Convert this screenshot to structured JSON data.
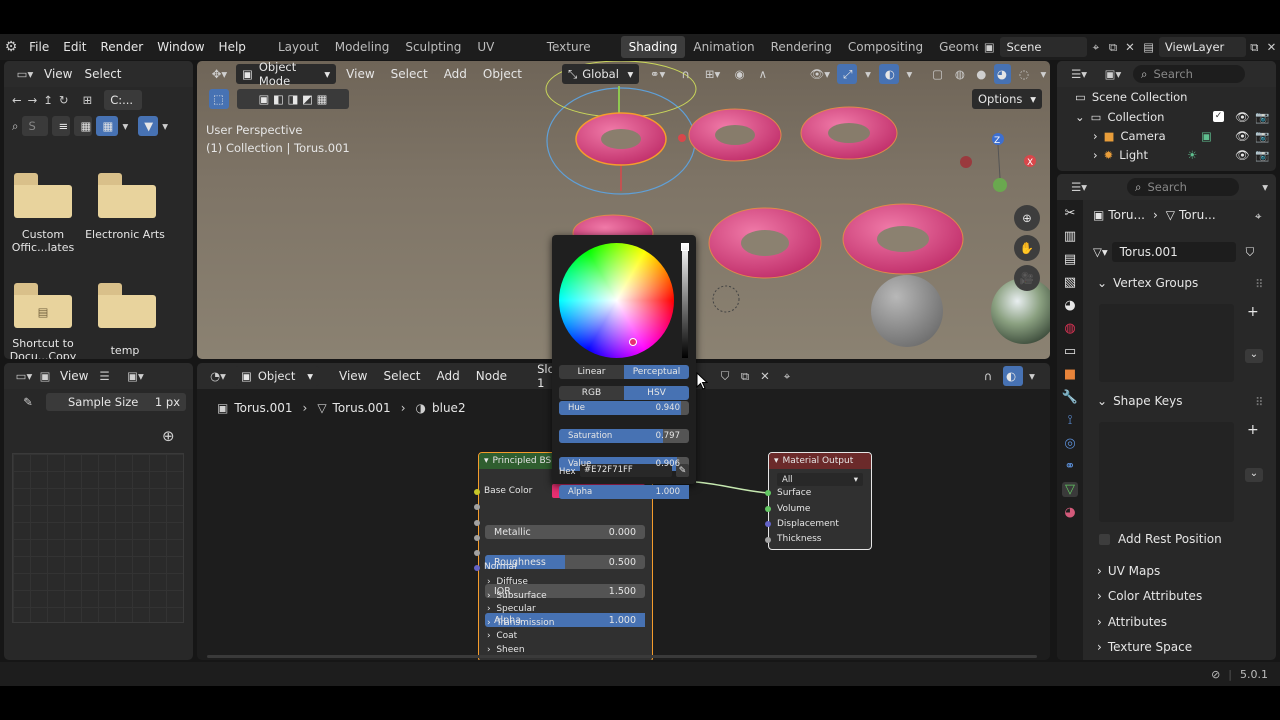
{
  "menubar": {
    "items": [
      "File",
      "Edit",
      "Render",
      "Window",
      "Help"
    ],
    "workspaces": [
      "Layout",
      "Modeling",
      "Sculpting",
      "UV Editing",
      "Texture Paint",
      "Shading",
      "Animation",
      "Rendering",
      "Compositing",
      "Geomet"
    ],
    "active_workspace": "Shading",
    "scene": "Scene",
    "view_layer": "ViewLayer"
  },
  "file_browser": {
    "view": "View",
    "select": "Select",
    "path": "C:...",
    "search_placeholder": "S",
    "items": [
      {
        "name": "Custom Offic...lates",
        "type": "folder"
      },
      {
        "name": "Electronic Arts",
        "type": "folder"
      },
      {
        "name": "Shortcut to Docu...Copy",
        "type": "shortcut"
      },
      {
        "name": "temp",
        "type": "folder"
      }
    ]
  },
  "image_editor": {
    "view": "View",
    "sample_label": "Sample Size",
    "sample_value": "1 px"
  },
  "viewport": {
    "mode": "Object Mode",
    "menus": [
      "View",
      "Select",
      "Add",
      "Object"
    ],
    "orientation": "Global",
    "options": "Options",
    "overlay_line1": "User Perspective",
    "overlay_line2": "(1) Collection | Torus.001",
    "gizmo_z": "Z",
    "gizmo_x": "X"
  },
  "node_editor": {
    "type": "Object",
    "menus": [
      "View",
      "Select",
      "Add",
      "Node"
    ],
    "slot": "Slot 1",
    "breadcrumb": [
      "Torus.001",
      "Torus.001",
      "blue2"
    ],
    "bsdf": {
      "title": "Principled BSDF",
      "base_color": "Base Color",
      "fields": [
        {
          "label": "Metallic",
          "value": "0.000",
          "fill": 0
        },
        {
          "label": "Roughness",
          "value": "0.500",
          "fill": 0.5
        },
        {
          "label": "IOR",
          "value": "1.500",
          "fill": 0
        },
        {
          "label": "Alpha",
          "value": "1.000",
          "fill": 1
        }
      ],
      "normal": "Normal",
      "panels": [
        "Diffuse",
        "Subsurface",
        "Specular",
        "Transmission",
        "Coat",
        "Sheen"
      ]
    },
    "output": {
      "title": "Material Output",
      "target": "All",
      "sockets": [
        "Surface",
        "Volume",
        "Displacement",
        "Thickness"
      ]
    }
  },
  "color_picker": {
    "mode_linear": "Linear",
    "mode_perceptual": "Perceptual",
    "tab_rgb": "RGB",
    "tab_hsv": "HSV",
    "fields": [
      {
        "label": "Hue",
        "value": "0.940",
        "fill": 0.94
      },
      {
        "label": "Saturation",
        "value": "0.797",
        "fill": 0.797
      },
      {
        "label": "Value",
        "value": "0.906",
        "fill": 0.906
      },
      {
        "label": "Alpha",
        "value": "1.000",
        "fill": 1
      }
    ],
    "hex_label": "Hex",
    "hex_value": "#E72F71FF",
    "color": "#e72f71"
  },
  "outliner": {
    "search_placeholder": "Search",
    "root": "Scene Collection",
    "collection": "Collection",
    "items": [
      "Camera",
      "Light"
    ]
  },
  "properties": {
    "search_placeholder": "Search",
    "crumb1": "Toru...",
    "crumb2": "Toru...",
    "mesh_name": "Torus.001",
    "vertex_groups": "Vertex Groups",
    "shape_keys": "Shape Keys",
    "add_rest": "Add Rest Position",
    "sections": [
      "UV Maps",
      "Color Attributes",
      "Attributes",
      "Texture Space"
    ]
  },
  "status": {
    "version": "5.0.1"
  },
  "colors": {
    "accent": "#4772b3",
    "selected": "#f59c2c",
    "pink": "#e72f71"
  }
}
